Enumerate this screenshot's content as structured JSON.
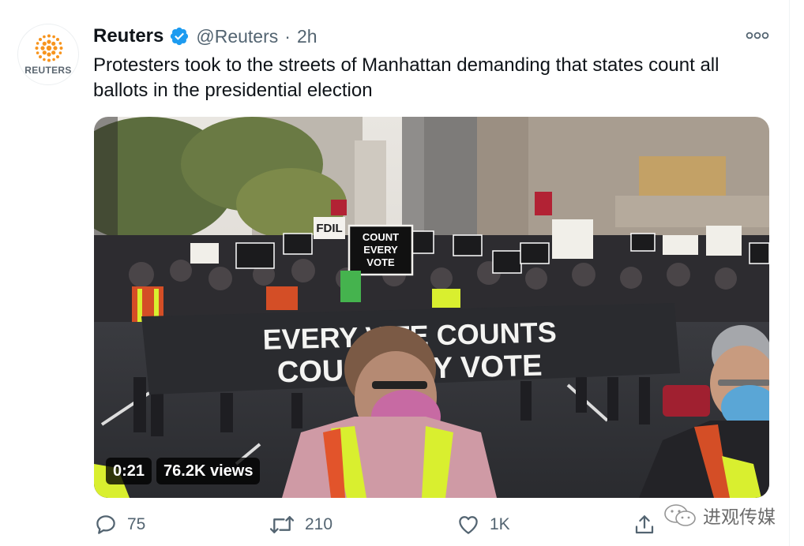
{
  "tweet": {
    "author_name": "Reuters",
    "handle": "@Reuters",
    "separator": "·",
    "time": "2h",
    "avatar_label": "REUTERS",
    "text": "Protesters took to the streets of Manhattan demanding that states count all ballots in the presidential election",
    "icons": {
      "verified": "verified-badge-icon",
      "more": "more-options-icon"
    },
    "colors": {
      "verified": "#1d9bf0",
      "reuters_orange": "#f7941d",
      "text_secondary": "#536471"
    }
  },
  "video": {
    "duration": "0:21",
    "views": "76.2K views",
    "signs": {
      "center": [
        "COUNT",
        "EVERY",
        "VOTE"
      ],
      "left": "FDIL"
    },
    "banner": {
      "line1": "EVERY V  TE COUNTS",
      "line2": "COUNT   ERY VOTE"
    }
  },
  "actions": {
    "replies": "75",
    "retweets": "210",
    "likes": "1K"
  },
  "watermark": {
    "text": "进观传媒"
  }
}
